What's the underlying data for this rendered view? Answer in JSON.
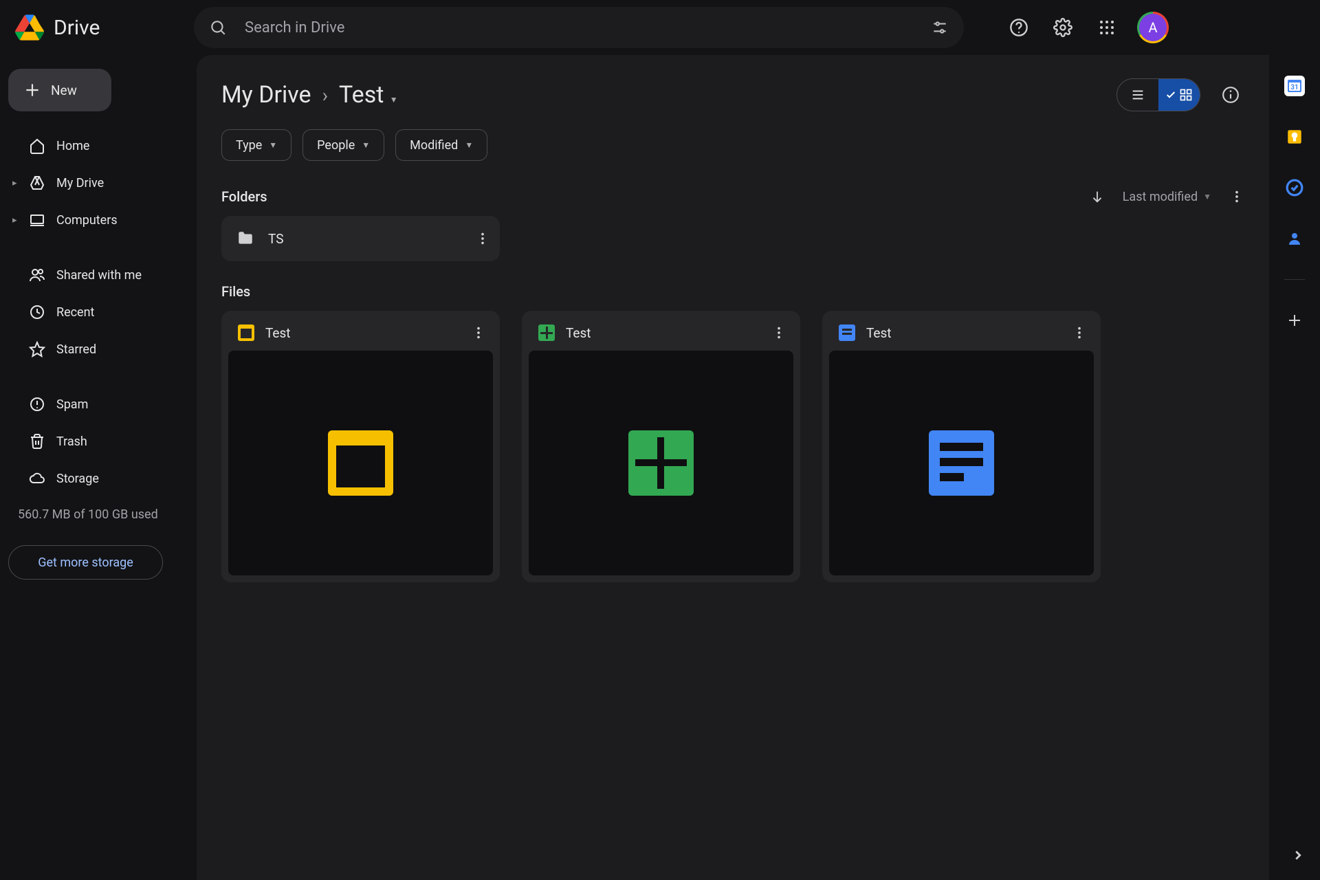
{
  "app": {
    "name": "Drive"
  },
  "search": {
    "placeholder": "Search in Drive"
  },
  "header": {
    "avatar_letter": "A"
  },
  "sidebar": {
    "new_label": "New",
    "items": [
      {
        "label": "Home",
        "icon": "home"
      },
      {
        "label": "My Drive",
        "icon": "mydrive",
        "expandable": true
      },
      {
        "label": "Computers",
        "icon": "computers",
        "expandable": true
      },
      {
        "label": "Shared with me",
        "icon": "shared"
      },
      {
        "label": "Recent",
        "icon": "recent"
      },
      {
        "label": "Starred",
        "icon": "starred"
      },
      {
        "label": "Spam",
        "icon": "spam"
      },
      {
        "label": "Trash",
        "icon": "trash"
      },
      {
        "label": "Storage",
        "icon": "storage"
      }
    ],
    "storage_text": "560.7 MB of 100 GB used",
    "get_more": "Get more storage"
  },
  "breadcrumb": {
    "root": "My Drive",
    "current": "Test"
  },
  "filters": {
    "type": "Type",
    "people": "People",
    "modified": "Modified"
  },
  "sort": {
    "label": "Last modified"
  },
  "sections": {
    "folders": "Folders",
    "files": "Files"
  },
  "folders": [
    {
      "name": "TS"
    }
  ],
  "files": [
    {
      "name": "Test",
      "type": "slides"
    },
    {
      "name": "Test",
      "type": "sheets"
    },
    {
      "name": "Test",
      "type": "docs"
    }
  ]
}
